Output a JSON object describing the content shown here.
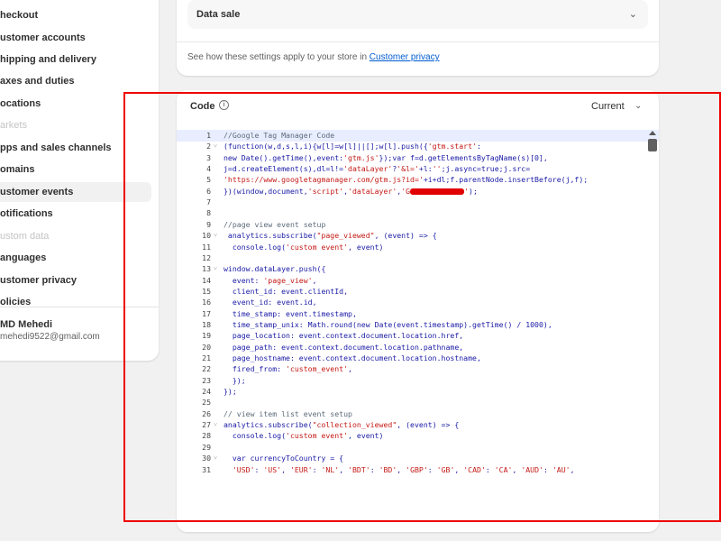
{
  "sidebar": {
    "items": [
      {
        "label": "heckout",
        "disabled": false,
        "active": false
      },
      {
        "label": "ustomer accounts",
        "disabled": false,
        "active": false
      },
      {
        "label": "hipping and delivery",
        "disabled": false,
        "active": false
      },
      {
        "label": "axes and duties",
        "disabled": false,
        "active": false
      },
      {
        "label": "ocations",
        "disabled": false,
        "active": false
      },
      {
        "label": "arkets",
        "disabled": true,
        "active": false
      },
      {
        "label": "pps and sales channels",
        "disabled": false,
        "active": false
      },
      {
        "label": "omains",
        "disabled": false,
        "active": false
      },
      {
        "label": "ustomer events",
        "disabled": false,
        "active": true
      },
      {
        "label": "otifications",
        "disabled": false,
        "active": false
      },
      {
        "label": "ustom data",
        "disabled": true,
        "active": false
      },
      {
        "label": "anguages",
        "disabled": false,
        "active": false
      },
      {
        "label": "ustomer privacy",
        "disabled": false,
        "active": false
      },
      {
        "label": "olicies",
        "disabled": false,
        "active": false
      }
    ],
    "user": {
      "name": "MD Mehedi",
      "email": "mehedi9522@gmail.com"
    }
  },
  "privacy_card": {
    "data_sale_label": "Data sale",
    "settings_text": "See how these settings apply to your store in ",
    "settings_link": "Customer privacy"
  },
  "code_card": {
    "title": "Code",
    "info_icon": "info-icon",
    "version": "Current",
    "active_line": 1
  },
  "code_lines": [
    {
      "n": "1",
      "fold": false,
      "segments": [
        {
          "t": "//Google Tag Manager Code",
          "c": "com"
        }
      ]
    },
    {
      "n": "2",
      "fold": true,
      "segments": [
        {
          "t": "(function(w,d,s,l,i){w[l]=w[l]||[];w[l].push({",
          "c": "var"
        },
        {
          "t": "'gtm.start'",
          "c": "str"
        },
        {
          "t": ":",
          "c": "var"
        }
      ]
    },
    {
      "n": "3",
      "fold": false,
      "segments": [
        {
          "t": "new Date().getTime(),event:",
          "c": "var"
        },
        {
          "t": "'gtm.js'",
          "c": "str"
        },
        {
          "t": "});var f=d.getElementsByTagName(s)[0],",
          "c": "var"
        }
      ]
    },
    {
      "n": "4",
      "fold": false,
      "segments": [
        {
          "t": "j=d.createElement(s),dl=l!=",
          "c": "var"
        },
        {
          "t": "'dataLayer'",
          "c": "str"
        },
        {
          "t": "?",
          "c": "var"
        },
        {
          "t": "'&l='",
          "c": "str"
        },
        {
          "t": "+l:",
          "c": "var"
        },
        {
          "t": "''",
          "c": "str"
        },
        {
          "t": ";j.async=true;j.src=",
          "c": "var"
        }
      ]
    },
    {
      "n": "5",
      "fold": false,
      "segments": [
        {
          "t": "'https://www.googletagmanager.com/gtm.js?id='",
          "c": "str"
        },
        {
          "t": "+i+dl;f.parentNode.insertBefore(j,f);",
          "c": "var"
        }
      ]
    },
    {
      "n": "6",
      "fold": false,
      "segments": [
        {
          "t": "})(window,document,",
          "c": "var"
        },
        {
          "t": "'script'",
          "c": "str"
        },
        {
          "t": ",",
          "c": "var"
        },
        {
          "t": "'dataLayer'",
          "c": "str"
        },
        {
          "t": ",",
          "c": "var"
        },
        {
          "t": "'G",
          "c": "str"
        },
        {
          "t": "",
          "c": "redact"
        },
        {
          "t": "'",
          "c": "str"
        },
        {
          "t": ");",
          "c": "var"
        }
      ]
    },
    {
      "n": "7",
      "fold": false,
      "segments": []
    },
    {
      "n": "8",
      "fold": false,
      "segments": []
    },
    {
      "n": "9",
      "fold": false,
      "segments": [
        {
          "t": "//page view event setup",
          "c": "com"
        }
      ]
    },
    {
      "n": "10",
      "fold": true,
      "segments": [
        {
          "t": " analytics.subscribe(",
          "c": "var"
        },
        {
          "t": "\"page_viewed\"",
          "c": "str"
        },
        {
          "t": ", (event) => {",
          "c": "var"
        }
      ]
    },
    {
      "n": "11",
      "fold": false,
      "segments": [
        {
          "t": "  console.log(",
          "c": "var"
        },
        {
          "t": "'custom event'",
          "c": "str"
        },
        {
          "t": ", event)",
          "c": "var"
        }
      ]
    },
    {
      "n": "12",
      "fold": false,
      "segments": []
    },
    {
      "n": "13",
      "fold": true,
      "segments": [
        {
          "t": "window.dataLayer.push({",
          "c": "var"
        }
      ]
    },
    {
      "n": "14",
      "fold": false,
      "segments": [
        {
          "t": "  event: ",
          "c": "var"
        },
        {
          "t": "'page_view'",
          "c": "str"
        },
        {
          "t": ",",
          "c": "var"
        }
      ]
    },
    {
      "n": "15",
      "fold": false,
      "segments": [
        {
          "t": "  client_id: event.clientId,",
          "c": "var"
        }
      ]
    },
    {
      "n": "16",
      "fold": false,
      "segments": [
        {
          "t": "  event_id: event.id,",
          "c": "var"
        }
      ]
    },
    {
      "n": "17",
      "fold": false,
      "segments": [
        {
          "t": "  time_stamp: event.timestamp,",
          "c": "var"
        }
      ]
    },
    {
      "n": "18",
      "fold": false,
      "segments": [
        {
          "t": "  time_stamp_unix: Math.round(new Date(event.timestamp).getTime() / 1000),",
          "c": "var"
        }
      ]
    },
    {
      "n": "19",
      "fold": false,
      "segments": [
        {
          "t": "  page_location: event.context.document.location.href,",
          "c": "var"
        }
      ]
    },
    {
      "n": "20",
      "fold": false,
      "segments": [
        {
          "t": "  page_path: event.context.document.location.pathname,",
          "c": "var"
        }
      ]
    },
    {
      "n": "21",
      "fold": false,
      "segments": [
        {
          "t": "  page_hostname: event.context.document.location.hostname,",
          "c": "var"
        }
      ]
    },
    {
      "n": "22",
      "fold": false,
      "segments": [
        {
          "t": "  fired_from: ",
          "c": "var"
        },
        {
          "t": "'custom_event'",
          "c": "str"
        },
        {
          "t": ",",
          "c": "var"
        }
      ]
    },
    {
      "n": "23",
      "fold": false,
      "segments": [
        {
          "t": "  });",
          "c": "var"
        }
      ]
    },
    {
      "n": "24",
      "fold": false,
      "segments": [
        {
          "t": "});",
          "c": "var"
        }
      ]
    },
    {
      "n": "25",
      "fold": false,
      "segments": []
    },
    {
      "n": "26",
      "fold": false,
      "segments": [
        {
          "t": "// view item list event setup",
          "c": "com"
        }
      ]
    },
    {
      "n": "27",
      "fold": true,
      "segments": [
        {
          "t": "analytics.subscribe(",
          "c": "var"
        },
        {
          "t": "\"collection_viewed\"",
          "c": "str"
        },
        {
          "t": ", (event) => {",
          "c": "var"
        }
      ]
    },
    {
      "n": "28",
      "fold": false,
      "segments": [
        {
          "t": "  console.log(",
          "c": "var"
        },
        {
          "t": "'custom event'",
          "c": "str"
        },
        {
          "t": ", event)",
          "c": "var"
        }
      ]
    },
    {
      "n": "29",
      "fold": false,
      "segments": []
    },
    {
      "n": "30",
      "fold": true,
      "segments": [
        {
          "t": "  var currencyToCountry = {",
          "c": "var"
        }
      ]
    },
    {
      "n": "31",
      "fold": false,
      "segments": [
        {
          "t": "  ",
          "c": "var"
        },
        {
          "t": "'USD'",
          "c": "str"
        },
        {
          "t": ": ",
          "c": "var"
        },
        {
          "t": "'US'",
          "c": "str"
        },
        {
          "t": ", ",
          "c": "var"
        },
        {
          "t": "'EUR'",
          "c": "str"
        },
        {
          "t": ": ",
          "c": "var"
        },
        {
          "t": "'NL'",
          "c": "str"
        },
        {
          "t": ", ",
          "c": "var"
        },
        {
          "t": "'BDT'",
          "c": "str"
        },
        {
          "t": ": ",
          "c": "var"
        },
        {
          "t": "'BD'",
          "c": "str"
        },
        {
          "t": ", ",
          "c": "var"
        },
        {
          "t": "'GBP'",
          "c": "str"
        },
        {
          "t": ": ",
          "c": "var"
        },
        {
          "t": "'GB'",
          "c": "str"
        },
        {
          "t": ", ",
          "c": "var"
        },
        {
          "t": "'CAD'",
          "c": "str"
        },
        {
          "t": ": ",
          "c": "var"
        },
        {
          "t": "'CA'",
          "c": "str"
        },
        {
          "t": ", ",
          "c": "var"
        },
        {
          "t": "'AUD'",
          "c": "str"
        },
        {
          "t": ": ",
          "c": "var"
        },
        {
          "t": "'AU'",
          "c": "str"
        },
        {
          "t": ",",
          "c": "var"
        }
      ]
    }
  ],
  "colors": {
    "highlight": "#ee0000",
    "link": "#005bd3",
    "string": "#c41a16",
    "keyword": "#1a1aa6"
  }
}
